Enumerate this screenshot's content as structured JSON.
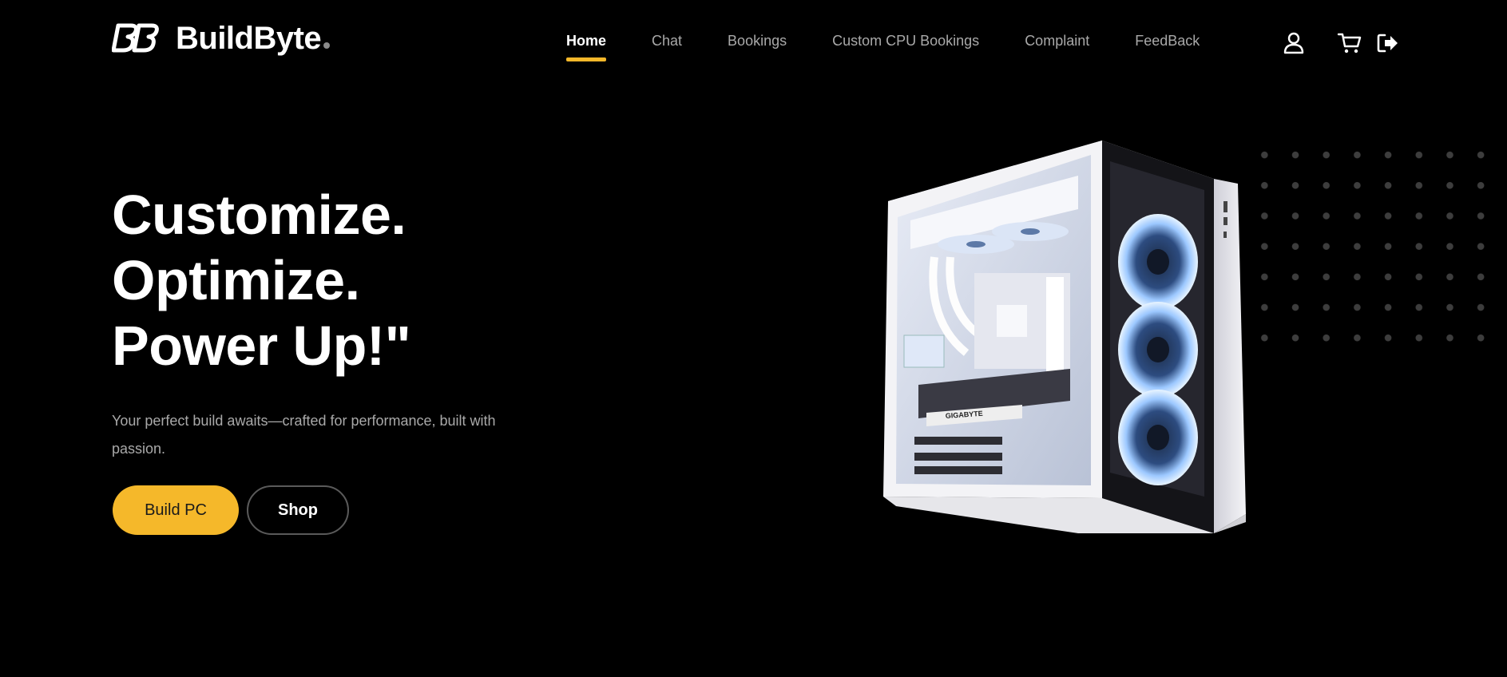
{
  "brand": {
    "name": "BuildByte"
  },
  "nav": {
    "items": [
      {
        "label": "Home",
        "active": true
      },
      {
        "label": "Chat",
        "active": false
      },
      {
        "label": "Bookings",
        "active": false
      },
      {
        "label": "Custom CPU Bookings",
        "active": false
      },
      {
        "label": "Complaint",
        "active": false
      },
      {
        "label": "FeedBack",
        "active": false
      }
    ]
  },
  "header_icons": [
    "user-icon",
    "cart-icon",
    "logout-icon"
  ],
  "hero": {
    "line1": "Customize.",
    "line2": "Optimize.",
    "line3": "Power Up!\"",
    "subtitle": "Your perfect build awaits—crafted for performance, built with passion.",
    "primary_button": "Build PC",
    "secondary_button": "Shop",
    "image": "pc-case-image"
  },
  "colors": {
    "accent": "#f5b82a",
    "background": "#000000",
    "muted_text": "#a9a9a9",
    "dots": "#3d3d3d"
  }
}
